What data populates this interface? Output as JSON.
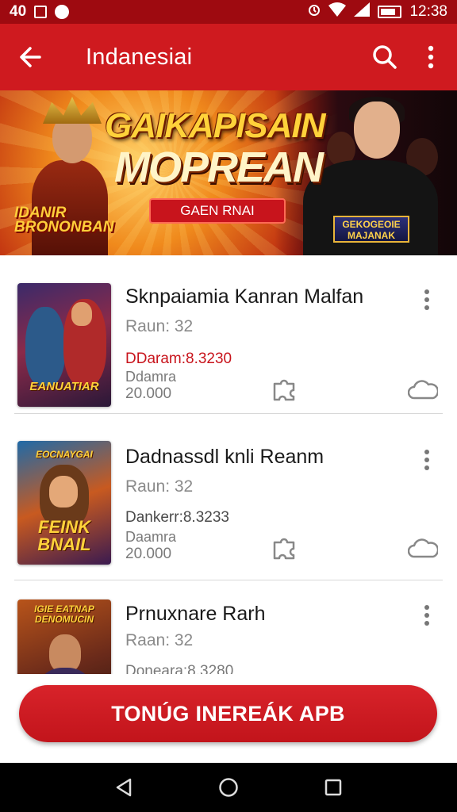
{
  "status_bar": {
    "left_text": "40",
    "time": "12:38",
    "icons": [
      "image-icon",
      "chat-icon",
      "alarm-icon",
      "wifi-icon",
      "signal-icon",
      "battery-icon"
    ]
  },
  "app_bar": {
    "title": "Indanesiai",
    "icons": [
      "back-arrow-icon",
      "search-icon",
      "more-vert-icon"
    ]
  },
  "banner": {
    "title_line1": "GAIKAPISAIN",
    "title_line2": "MOPREAN",
    "cta_label": "GAEN RNAI",
    "logo_left": "IDANIR BRONONBAN",
    "logo_right": "GEKOGEOIE MAJANAK"
  },
  "items": [
    {
      "title": "Sknpaiamia Kanran Malfan",
      "subtitle": "Raun: 32",
      "price": "DDaram:8.3230",
      "price_color": "#c8141c",
      "detail_line1": "Ddamra",
      "detail_line2": "20.000",
      "thumb_label": "EANUATIAR",
      "icons": [
        "more-vert-icon",
        "puzzle-icon",
        "cloud-icon"
      ]
    },
    {
      "title": "Dadnassdl knli Reanm",
      "subtitle": "Raun: 32",
      "price": "Dankerr:8.3233",
      "price_color": "#4a4a4a",
      "detail_line1": "Daamra",
      "detail_line2": "20.000",
      "thumb_label": "FEINK BNAIL",
      "thumb_top_label": "EOCNAYGAI",
      "icons": [
        "more-vert-icon",
        "puzzle-icon",
        "cloud-icon"
      ]
    },
    {
      "title": "Prnuxnare Rarh",
      "subtitle": "Raan: 32",
      "price": "Doneara:8.3280",
      "price_color": "#7a7a7a",
      "thumb_label": "IGIE EATNAP DENOMUCIN",
      "icons": [
        "more-vert-icon"
      ]
    }
  ],
  "cta": {
    "label": "TONÚG INEREÁK APB"
  },
  "nav_bar": {
    "icons": [
      "back-triangle-icon",
      "home-circle-icon",
      "recents-square-icon"
    ]
  },
  "colors": {
    "brand_red": "#cf1a1f",
    "status_red": "#9e0a10",
    "button_red": "#d8232a"
  }
}
